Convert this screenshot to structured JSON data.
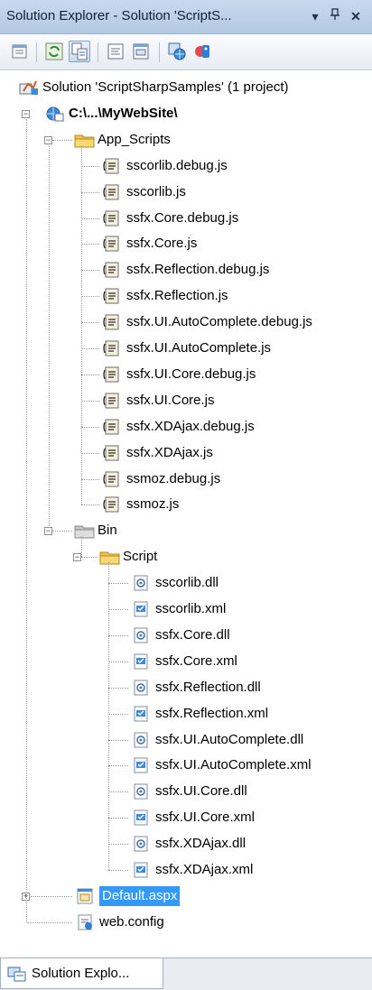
{
  "window": {
    "title": "Solution Explorer - Solution 'ScriptS...",
    "dropdown_glyph": "▾",
    "pin_glyph": "↕",
    "close_glyph": "✕"
  },
  "toolbar": {
    "buttons": [
      "properties",
      "refresh",
      "show-all-files",
      "view-code",
      "view-designer",
      "copy-web-site",
      "asp-net-configuration"
    ]
  },
  "tree": {
    "solution": "Solution 'ScriptSharpSamples' (1 project)",
    "project": "C:\\...\\MyWebSite\\",
    "app_scripts": {
      "label": "App_Scripts",
      "files": [
        "sscorlib.debug.js",
        "sscorlib.js",
        "ssfx.Core.debug.js",
        "ssfx.Core.js",
        "ssfx.Reflection.debug.js",
        "ssfx.Reflection.js",
        "ssfx.UI.AutoComplete.debug.js",
        "ssfx.UI.AutoComplete.js",
        "ssfx.UI.Core.debug.js",
        "ssfx.UI.Core.js",
        "ssfx.XDAjax.debug.js",
        "ssfx.XDAjax.js",
        "ssmoz.debug.js",
        "ssmoz.js"
      ]
    },
    "bin": {
      "label": "Bin",
      "script": {
        "label": "Script",
        "files": [
          "sscorlib.dll",
          "sscorlib.xml",
          "ssfx.Core.dll",
          "ssfx.Core.xml",
          "ssfx.Reflection.dll",
          "ssfx.Reflection.xml",
          "ssfx.UI.AutoComplete.dll",
          "ssfx.UI.AutoComplete.xml",
          "ssfx.UI.Core.dll",
          "ssfx.UI.Core.xml",
          "ssfx.XDAjax.dll",
          "ssfx.XDAjax.xml"
        ]
      }
    },
    "default_aspx": "Default.aspx",
    "web_config": "web.config"
  },
  "bottom_tab": {
    "label": "Solution Explo..."
  },
  "colors": {
    "selection": "#3399ff",
    "folder": "#f3c24d",
    "title_bar": "#c9d9ee"
  }
}
